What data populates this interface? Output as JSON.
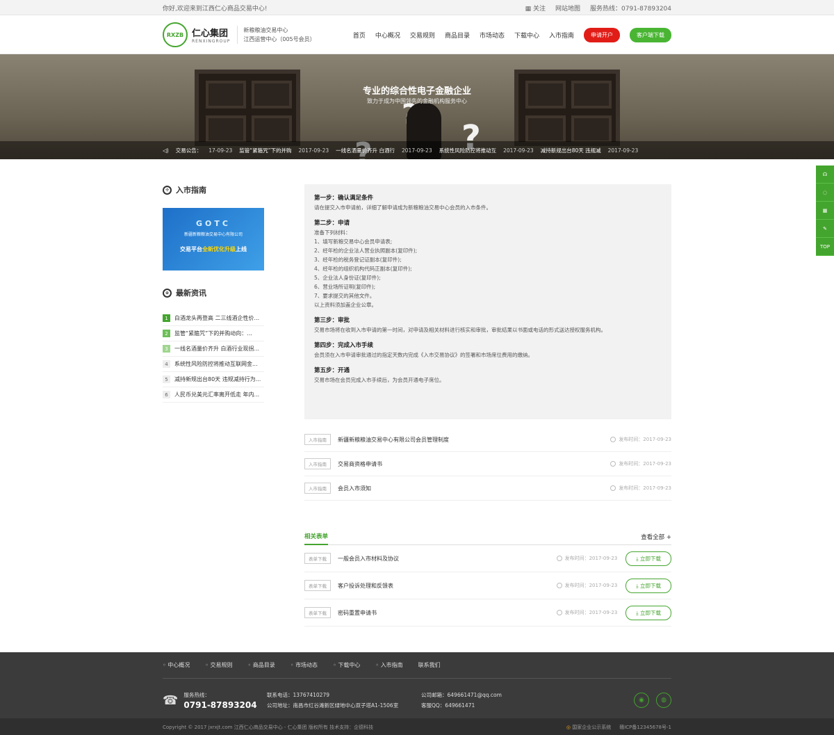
{
  "topbar": {
    "welcome": "你好,欢迎来到江西仁心商品交易中心!",
    "follow": "关注",
    "sitemap": "网站地图",
    "hotline": "服务热线：0791-87893204"
  },
  "header": {
    "logo_mark": "RXZB",
    "logo_cn": "仁心集团",
    "logo_en": "RENXINGROUP",
    "sub1": "新粮粮油交易中心",
    "sub2": "江西运营中心（005号会员）",
    "nav": [
      "首页",
      "中心概况",
      "交易规则",
      "商品目录",
      "市场动态",
      "下载中心",
      "入市指南"
    ],
    "btn_apply": "申请开户",
    "btn_client": "客户端下载"
  },
  "banner": {
    "title": "专业的综合性电子金融企业",
    "subtitle": "致力于成为中国领先的金融机构服务中心",
    "notice_label": "交易公告：",
    "notices": [
      {
        "text": "",
        "date": "17-09-23"
      },
      {
        "text": "监管“紧箍咒”下的并购",
        "date": "2017-09-23"
      },
      {
        "text": "一线名酒量价齐升 白酒行",
        "date": "2017-09-23"
      },
      {
        "text": "系统性风险防控将推动互",
        "date": "2017-09-23"
      },
      {
        "text": "减持新规出台80天 违规减",
        "date": "2017-09-23"
      }
    ]
  },
  "sidebar": {
    "guide_title": "入市指南",
    "promo_big": "GOTC",
    "promo_t1": "新疆新粮粮油交易中心有限公司",
    "promo_t2a": "交易平台",
    "promo_t2b": "全新优化升级",
    "promo_t2c": "上线",
    "news_title": "最新资讯",
    "news": [
      {
        "n": "1",
        "text": "白酒龙头再登高 二三线酒企性价..."
      },
      {
        "n": "2",
        "text": "监管“紧箍咒”下的并购动向：..."
      },
      {
        "n": "3",
        "text": "一线名酒量价齐升 白酒行业现拐..."
      },
      {
        "n": "4",
        "text": "系统性风险防控将推动互联网金..."
      },
      {
        "n": "5",
        "text": "减持新规出台80天 违规减持行为..."
      },
      {
        "n": "6",
        "text": "人民币兑美元汇率离开低走 年内..."
      }
    ]
  },
  "guide": {
    "s1_title": "第一步：确认满足条件",
    "s1_body": "请在提交入市申请前，详细了解申请成为新粮粮油交易中心会员的入市条件。",
    "s2_title": "第二步：申请",
    "s2_lines": [
      "准备下列材料：",
      "1、填写新粮交易中心会员申请表;",
      "2、经年检的企业法人营业执照副本(复印件);",
      "3、经年检的税务登记证副本(复印件);",
      "4、经年检的组织机构代码正副本(复印件);",
      "5、企业法人身份证(复印件);",
      "6、营业场所证明(复印件);",
      "7、要求提交的其他文件。",
      "以上资料须加盖企业公章。"
    ],
    "s3_title": "第三步：审批",
    "s3_body": "交易市场将在收到入市申请的第一时间，对申请及相关材料进行核实和审批，审批结果以书面或电话的形式送达授权服务机构。",
    "s4_title": "第四步：完成入市手续",
    "s4_body": "会员须在入市申请审批通过的指定天数内完成《入市交易协议》的签署和市场席位费用的缴纳。",
    "s5_title": "第五步：开通",
    "s5_body": "交易市场在会员完成入市手续后，为会员开通电子席位。"
  },
  "articles": [
    {
      "tag": "入市指南",
      "title": "新疆新粮粮油交易中心有限公司会员管理制度",
      "date": "发布时间：2017-09-23"
    },
    {
      "tag": "入市指南",
      "title": "交易商资格申请书",
      "date": "发布时间：2017-09-23"
    },
    {
      "tag": "入市指南",
      "title": "会员入市须知",
      "date": "发布时间：2017-09-23"
    }
  ],
  "forms": {
    "title": "相关表单",
    "more": "查看全部 +",
    "download_label": "立即下载",
    "items": [
      {
        "tag": "表单下载",
        "title": "一般会员入市材料及协议",
        "date": "发布时间：2017-09-23"
      },
      {
        "tag": "表单下载",
        "title": "客户投诉处理和反馈表",
        "date": "发布时间：2017-09-23"
      },
      {
        "tag": "表单下载",
        "title": "密码重置申请书",
        "date": "发布时间：2017-09-23"
      }
    ]
  },
  "float": {
    "top": "TOP"
  },
  "footer": {
    "links": [
      "中心概况",
      "交易规则",
      "商品目录",
      "市场动态",
      "下载中心",
      "入市指南",
      "联系我们"
    ],
    "hotline_label": "服务热线：",
    "hotline": "0791-87893204",
    "phone": "联系电话：13767410279",
    "address": "公司地址：南昌市红谷滩新区绿地中心双子塔A1-1506室",
    "email": "公司邮箱：649661471@qq.com",
    "qq": "客服QQ：649661471",
    "copyright": "Copyright © 2017 jxrxjt.com 江西仁心商品交易中心 - 仁心集团 版权所有  技术支持：企德科技",
    "gov": "国家企业公示系统",
    "icp": "赣ICP备12345678号-1"
  }
}
